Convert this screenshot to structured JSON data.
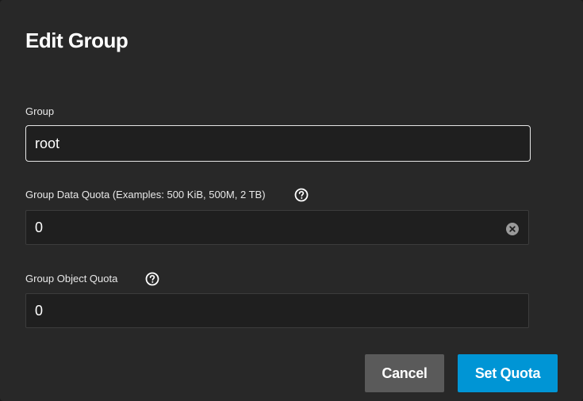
{
  "dialog": {
    "title": "Edit Group"
  },
  "fields": {
    "group": {
      "label": "Group",
      "value": "root"
    },
    "data_quota": {
      "label": "Group Data Quota (Examples: 500 KiB, 500M, 2 TB)",
      "value": "0",
      "help_icon": "help-circle-icon",
      "clear_icon": "clear-circle-icon"
    },
    "object_quota": {
      "label": "Group Object Quota",
      "value": "0",
      "help_icon": "help-circle-icon"
    }
  },
  "actions": {
    "cancel_label": "Cancel",
    "submit_label": "Set Quota"
  },
  "colors": {
    "background": "#282828",
    "field_background": "#1f1f1f",
    "primary": "#0095d5",
    "secondary": "#5a5a5a"
  }
}
